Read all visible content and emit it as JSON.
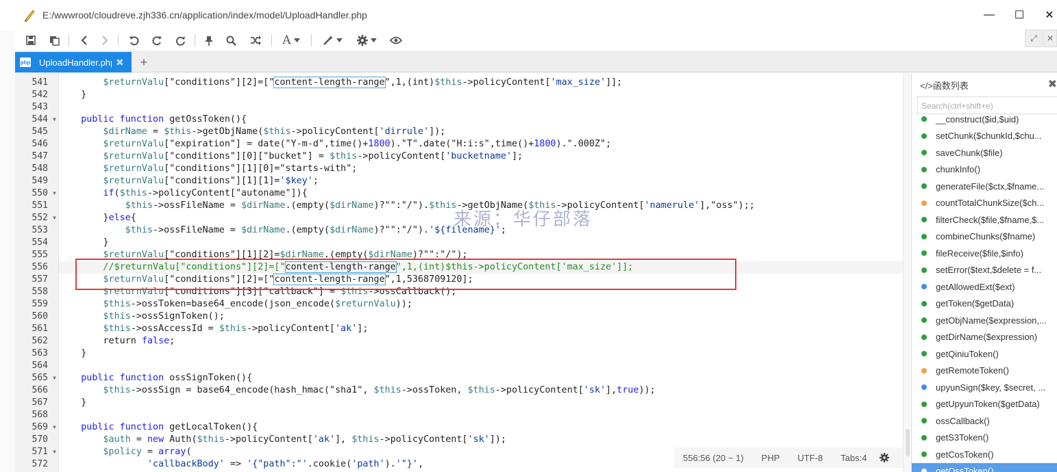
{
  "window": {
    "title_path": "E:/wwwroot/cloudreve.zjh336.cn/application/index/model/UploadHandler.php",
    "minimize_glyph": "—",
    "maximize_glyph": "☐",
    "close_glyph": "✕"
  },
  "toolbar": {
    "icons": [
      "save-icon",
      "save-all-icon",
      "back-icon",
      "forward-icon",
      "undo-icon",
      "redo-icon",
      "refresh-icon",
      "pin-icon",
      "search-icon",
      "shuffle-icon",
      "font-icon",
      "magic-wand-icon",
      "settings-icon",
      "eye-icon"
    ],
    "font_glyph": "A",
    "expand_glyph": "⤢",
    "close_panel_glyph": "✕"
  },
  "tabs": {
    "active_label": "UploadHandler.php",
    "file_badge": "php",
    "close_glyph": "✖",
    "add_glyph": "+"
  },
  "editor": {
    "lines": [
      {
        "n": "541",
        "fold": false,
        "tokens": [
          [
            "        ",
            ""
          ],
          [
            "$returnValu",
            "var"
          ],
          [
            "[\"conditions\"][2]=[\"",
            ""
          ],
          [
            "content-length-range",
            "hl"
          ],
          [
            "\",1,(int)",
            ""
          ],
          [
            "$this",
            "var"
          ],
          [
            "->policyContent[",
            ""
          ],
          [
            "'max_size'",
            "str"
          ],
          [
            "]];",
            ""
          ]
        ]
      },
      {
        "n": "542",
        "fold": false,
        "tokens": [
          [
            "    }",
            ""
          ]
        ]
      },
      {
        "n": "543",
        "fold": false,
        "tokens": [
          [
            "",
            ""
          ]
        ]
      },
      {
        "n": "544",
        "fold": true,
        "tokens": [
          [
            "    ",
            ""
          ],
          [
            "public function",
            "kw"
          ],
          [
            " getOssToken(){",
            ""
          ]
        ]
      },
      {
        "n": "545",
        "fold": false,
        "tokens": [
          [
            "        ",
            ""
          ],
          [
            "$dirName",
            "var"
          ],
          [
            " = ",
            ""
          ],
          [
            "$this",
            "var"
          ],
          [
            "->getObjName(",
            ""
          ],
          [
            "$this",
            "var"
          ],
          [
            "->policyContent[",
            ""
          ],
          [
            "'dirrule'",
            "str"
          ],
          [
            "]);",
            ""
          ]
        ]
      },
      {
        "n": "546",
        "fold": false,
        "tokens": [
          [
            "        ",
            ""
          ],
          [
            "$returnValu",
            "var"
          ],
          [
            "[\"expiration\"] = date(\"Y-m-d\",time()+",
            ""
          ],
          [
            "1800",
            "num"
          ],
          [
            ").\"T\".date(\"H:i:s\",time()+",
            ""
          ],
          [
            "1800",
            "num"
          ],
          [
            ").\".000Z\";",
            ""
          ]
        ]
      },
      {
        "n": "547",
        "fold": false,
        "tokens": [
          [
            "        ",
            ""
          ],
          [
            "$returnValu",
            "var"
          ],
          [
            "[\"conditions\"][0][\"bucket\"] = ",
            ""
          ],
          [
            "$this",
            "var"
          ],
          [
            "->policyContent[",
            ""
          ],
          [
            "'bucketname'",
            "str"
          ],
          [
            "];",
            ""
          ]
        ]
      },
      {
        "n": "548",
        "fold": false,
        "tokens": [
          [
            "        ",
            ""
          ],
          [
            "$returnValu",
            "var"
          ],
          [
            "[\"conditions\"][1][0]=\"starts-with\";",
            ""
          ]
        ]
      },
      {
        "n": "549",
        "fold": false,
        "tokens": [
          [
            "        ",
            ""
          ],
          [
            "$returnValu",
            "var"
          ],
          [
            "[\"conditions\"][1][1]=",
            ""
          ],
          [
            "'$key'",
            "str"
          ],
          [
            ";",
            ""
          ]
        ]
      },
      {
        "n": "550",
        "fold": true,
        "tokens": [
          [
            "        ",
            ""
          ],
          [
            "if",
            "kw"
          ],
          [
            "(",
            ""
          ],
          [
            "$this",
            "var"
          ],
          [
            "->policyContent[\"autoname\"]){",
            ""
          ]
        ]
      },
      {
        "n": "551",
        "fold": false,
        "tokens": [
          [
            "            ",
            ""
          ],
          [
            "$this",
            "var"
          ],
          [
            "->ossFileName = ",
            ""
          ],
          [
            "$dirName",
            "var"
          ],
          [
            ".(empty(",
            ""
          ],
          [
            "$dirName",
            "var"
          ],
          [
            ")?\"\":\"/\").",
            ""
          ],
          [
            "$this",
            "var"
          ],
          [
            "->getObjName(",
            ""
          ],
          [
            "$this",
            "var"
          ],
          [
            "->policyContent[",
            ""
          ],
          [
            "'namerule'",
            "str"
          ],
          [
            "],\"oss\");;",
            ""
          ]
        ]
      },
      {
        "n": "552",
        "fold": true,
        "tokens": [
          [
            "        }",
            ""
          ],
          [
            "else",
            "kw"
          ],
          [
            "{",
            ""
          ]
        ]
      },
      {
        "n": "553",
        "fold": false,
        "tokens": [
          [
            "            ",
            ""
          ],
          [
            "$this",
            "var"
          ],
          [
            "->ossFileName = ",
            ""
          ],
          [
            "$dirName",
            "var"
          ],
          [
            ".(empty(",
            ""
          ],
          [
            "$dirName",
            "var"
          ],
          [
            ")?\"\":\"/\").",
            ""
          ],
          [
            "'${filename}'",
            "str"
          ],
          [
            ";",
            ""
          ]
        ]
      },
      {
        "n": "554",
        "fold": false,
        "tokens": [
          [
            "        }",
            ""
          ]
        ]
      },
      {
        "n": "555",
        "fold": false,
        "tokens": [
          [
            "        ",
            ""
          ],
          [
            "$returnValu",
            "var"
          ],
          [
            "[\"conditions\"][1][2]=",
            ""
          ],
          [
            "$dirName",
            "var"
          ],
          [
            ".(empty(",
            ""
          ],
          [
            "$dirName",
            "var"
          ],
          [
            ")?\"\":\"/\");",
            ""
          ]
        ]
      },
      {
        "n": "556",
        "fold": false,
        "cur": true,
        "tokens": [
          [
            "        ",
            ""
          ],
          [
            "//$returnValu[\"conditions\"][2]=[\"",
            "cm"
          ],
          [
            "content-length-range",
            "hl"
          ],
          [
            "\",1,(int)$this->policyContent['max_size']];",
            "cm"
          ]
        ]
      },
      {
        "n": "557",
        "fold": false,
        "tokens": [
          [
            "        ",
            ""
          ],
          [
            "$returnValu",
            "var"
          ],
          [
            "[\"conditions\"][2]=[\"",
            ""
          ],
          [
            "content-length-range",
            "hl"
          ],
          [
            "\",1,5368709120];",
            ""
          ]
        ]
      },
      {
        "n": "558",
        "fold": false,
        "tokens": [
          [
            "        ",
            ""
          ],
          [
            "$returnValu",
            "var"
          ],
          [
            "[\"conditions\"][3][\"callback\"] = ",
            ""
          ],
          [
            "$this",
            "var"
          ],
          [
            "->ossCallback();",
            ""
          ]
        ]
      },
      {
        "n": "559",
        "fold": false,
        "tokens": [
          [
            "        ",
            ""
          ],
          [
            "$this",
            "var"
          ],
          [
            "->ossToken=base64_encode(json_encode(",
            ""
          ],
          [
            "$returnValu",
            "var"
          ],
          [
            "));",
            ""
          ]
        ]
      },
      {
        "n": "560",
        "fold": false,
        "tokens": [
          [
            "        ",
            ""
          ],
          [
            "$this",
            "var"
          ],
          [
            "->ossSignToken();",
            ""
          ]
        ]
      },
      {
        "n": "561",
        "fold": false,
        "tokens": [
          [
            "        ",
            ""
          ],
          [
            "$this",
            "var"
          ],
          [
            "->ossAccessId = ",
            ""
          ],
          [
            "$this",
            "var"
          ],
          [
            "->policyContent[",
            ""
          ],
          [
            "'ak'",
            "str"
          ],
          [
            "];",
            ""
          ]
        ]
      },
      {
        "n": "562",
        "fold": false,
        "tokens": [
          [
            "        return ",
            ""
          ],
          [
            "false",
            "kw"
          ],
          [
            ";",
            ""
          ]
        ]
      },
      {
        "n": "563",
        "fold": false,
        "tokens": [
          [
            "    }",
            ""
          ]
        ]
      },
      {
        "n": "564",
        "fold": false,
        "tokens": [
          [
            "",
            ""
          ]
        ]
      },
      {
        "n": "565",
        "fold": true,
        "tokens": [
          [
            "    ",
            ""
          ],
          [
            "public function",
            "kw"
          ],
          [
            " ossSignToken(){",
            ""
          ]
        ]
      },
      {
        "n": "566",
        "fold": false,
        "tokens": [
          [
            "        ",
            ""
          ],
          [
            "$this",
            "var"
          ],
          [
            "->ossSign = base64_encode(hash_hmac(\"sha1\", ",
            ""
          ],
          [
            "$this",
            "var"
          ],
          [
            "->ossToken, ",
            ""
          ],
          [
            "$this",
            "var"
          ],
          [
            "->policyContent[",
            ""
          ],
          [
            "'sk'",
            "str"
          ],
          [
            "],",
            ""
          ],
          [
            "true",
            "kw"
          ],
          [
            "));",
            ""
          ]
        ]
      },
      {
        "n": "567",
        "fold": false,
        "tokens": [
          [
            "    }",
            ""
          ]
        ]
      },
      {
        "n": "568",
        "fold": false,
        "tokens": [
          [
            "",
            ""
          ]
        ]
      },
      {
        "n": "569",
        "fold": true,
        "tokens": [
          [
            "    ",
            ""
          ],
          [
            "public function",
            "kw"
          ],
          [
            " getLocalToken(){",
            ""
          ]
        ]
      },
      {
        "n": "570",
        "fold": false,
        "tokens": [
          [
            "        ",
            ""
          ],
          [
            "$auth",
            "var"
          ],
          [
            " = ",
            ""
          ],
          [
            "new",
            "kw"
          ],
          [
            " Auth(",
            ""
          ],
          [
            "$this",
            "var"
          ],
          [
            "->policyContent[",
            ""
          ],
          [
            "'ak'",
            "str"
          ],
          [
            "], ",
            ""
          ],
          [
            "$this",
            "var"
          ],
          [
            "->policyContent[",
            ""
          ],
          [
            "'sk'",
            "str"
          ],
          [
            "]);",
            ""
          ]
        ]
      },
      {
        "n": "571",
        "fold": true,
        "tokens": [
          [
            "        ",
            ""
          ],
          [
            "$policy",
            "var"
          ],
          [
            " = ",
            ""
          ],
          [
            "array",
            "kw"
          ],
          [
            "(",
            ""
          ]
        ]
      },
      {
        "n": "572",
        "fold": false,
        "tokens": [
          [
            "                ",
            ""
          ],
          [
            "'callbackBody'",
            "str"
          ],
          [
            " => ",
            ""
          ],
          [
            "'{\"path\":\"'",
            "str"
          ],
          [
            ".cookie(",
            ""
          ],
          [
            "'path'",
            "str"
          ],
          [
            ").",
            ""
          ],
          [
            "'\"}'",
            "str"
          ],
          [
            ",",
            ""
          ]
        ]
      }
    ]
  },
  "watermark": "来源：华仔部落",
  "status": {
    "position": "556:56 (20 ~ 1)",
    "language": "PHP",
    "encoding": "UTF-8",
    "tabs": "Tabs:4"
  },
  "function_list": {
    "header": "</>函数列表",
    "search_placeholder": "Search(ctrl+shift+e)",
    "items": [
      {
        "label": "__construct($id,$uid)",
        "color": "#2e9e3e"
      },
      {
        "label": "setChunk($chunkId,$chu...",
        "color": "#2e9e3e"
      },
      {
        "label": "saveChunk($file)",
        "color": "#2e9e3e"
      },
      {
        "label": "chunkInfo()",
        "color": "#2e9e3e"
      },
      {
        "label": "generateFile($ctx,$fname...",
        "color": "#2e9e3e"
      },
      {
        "label": "countTotalChunkSize($ch...",
        "color": "#f0a04b"
      },
      {
        "label": "filterCheck($file,$fname,$...",
        "color": "#2e9e3e"
      },
      {
        "label": "combineChunks($fname)",
        "color": "#2e9e3e"
      },
      {
        "label": "fileReceive($file,$info)",
        "color": "#2e9e3e"
      },
      {
        "label": "setError($text,$delete = f...",
        "color": "#2e9e3e"
      },
      {
        "label": "getAllowedExt($ext)",
        "color": "#3b8ee8"
      },
      {
        "label": "getToken($getData)",
        "color": "#2e9e3e"
      },
      {
        "label": "getObjName($expression,...",
        "color": "#2e9e3e"
      },
      {
        "label": "getDirName($expression)",
        "color": "#2e9e3e"
      },
      {
        "label": "getQiniuToken()",
        "color": "#2e9e3e"
      },
      {
        "label": "getRemoteToken()",
        "color": "#f0a04b"
      },
      {
        "label": "upyunSign($key, $secret, ...",
        "color": "#3b8ee8"
      },
      {
        "label": "getUpyunToken($getData)",
        "color": "#2e9e3e"
      },
      {
        "label": "ossCallback()",
        "color": "#2e9e3e"
      },
      {
        "label": "getS3Token()",
        "color": "#2e9e3e"
      },
      {
        "label": "getCosToken()",
        "color": "#2e9e3e"
      },
      {
        "label": "getOssToken()",
        "color": "#2e9e3e",
        "selected": true
      }
    ]
  }
}
